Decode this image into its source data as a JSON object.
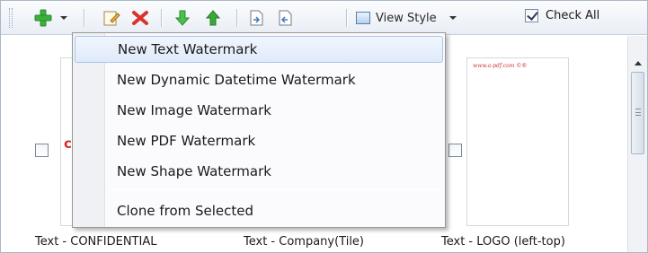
{
  "toolbar": {
    "view_style_label": "View Style",
    "check_all_label": "Check All",
    "check_all_checked": true
  },
  "menu": {
    "items": [
      {
        "label": "New Text Watermark",
        "highlighted": true
      },
      {
        "label": "New Dynamic Datetime Watermark"
      },
      {
        "label": "New Image Watermark"
      },
      {
        "label": "New PDF Watermark"
      },
      {
        "label": "New Shape Watermark"
      }
    ],
    "clone_label": "Clone from Selected"
  },
  "items": [
    {
      "caption": "Text - CONFIDENTIAL",
      "checked": false
    },
    {
      "caption": "Text - Company(Tile)",
      "checked": false
    },
    {
      "caption": "Text - LOGO (left-top)",
      "checked": false,
      "preview_text": "www.a-pdf.com ©®"
    }
  ],
  "colors": {
    "add_icon": "#3cae3c",
    "delete_icon": "#d9342b",
    "menu_highlight": "#dfeafa",
    "preview_text": "#cc3333"
  }
}
